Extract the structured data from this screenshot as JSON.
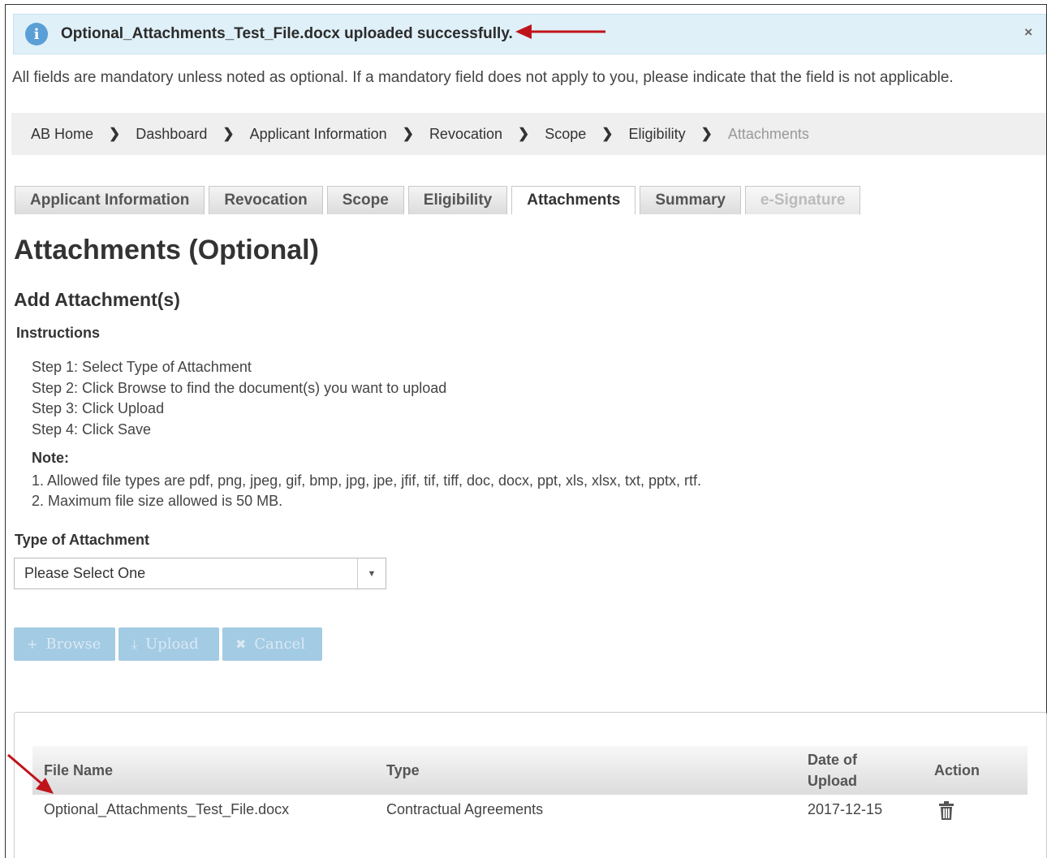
{
  "alert": {
    "message": "Optional_Attachments_Test_File.docx uploaded successfully.",
    "icon": "info-icon",
    "close_symbol": "×"
  },
  "mandatory_text": "All fields are mandatory unless noted as optional. If a mandatory field does not apply to you, please indicate that the field is not applicable.",
  "breadcrumb": {
    "items": [
      "AB Home",
      "Dashboard",
      "Applicant Information",
      "Revocation",
      "Scope",
      "Eligibility",
      "Attachments"
    ],
    "current": "Attachments"
  },
  "tabs": [
    {
      "label": "Applicant Information",
      "state": "normal"
    },
    {
      "label": "Revocation",
      "state": "normal"
    },
    {
      "label": "Scope",
      "state": "normal"
    },
    {
      "label": "Eligibility",
      "state": "normal"
    },
    {
      "label": "Attachments",
      "state": "active"
    },
    {
      "label": "Summary",
      "state": "normal"
    },
    {
      "label": "e-Signature",
      "state": "disabled"
    }
  ],
  "page_title": "Attachments (Optional)",
  "section_title": "Add Attachment(s)",
  "instructions_label": "Instructions",
  "steps": [
    "Step 1: Select Type of Attachment",
    "Step 2: Click Browse to find the document(s) you want to upload",
    "Step 3: Click Upload",
    "Step 4: Click Save"
  ],
  "note_label": "Note:",
  "notes": [
    "1. Allowed file types are pdf, png, jpeg, gif, bmp, jpg, jpe, jfif, tif, tiff, doc, docx, ppt, xls, xlsx, txt, pptx, rtf.",
    "2. Maximum file size allowed is 50 MB."
  ],
  "type_of_attachment": {
    "label": "Type of Attachment",
    "selected": "Please Select One"
  },
  "buttons": {
    "browse": "Browse",
    "upload": "Upload",
    "cancel": "Cancel"
  },
  "table": {
    "columns": {
      "file_name": "File Name",
      "type": "Type",
      "date_line1": "Date of",
      "date_line2": "Upload",
      "action": "Action"
    },
    "rows": [
      {
        "file_name": "Optional_Attachments_Test_File.docx",
        "type": "Contractual Agreements",
        "date": "2017-12-15",
        "action_icon": "trash-icon"
      }
    ]
  },
  "colors": {
    "alert_bg": "#dff0f8",
    "annotation_arrow": "#c0141b",
    "disabled_button": "#a3cbe4"
  }
}
